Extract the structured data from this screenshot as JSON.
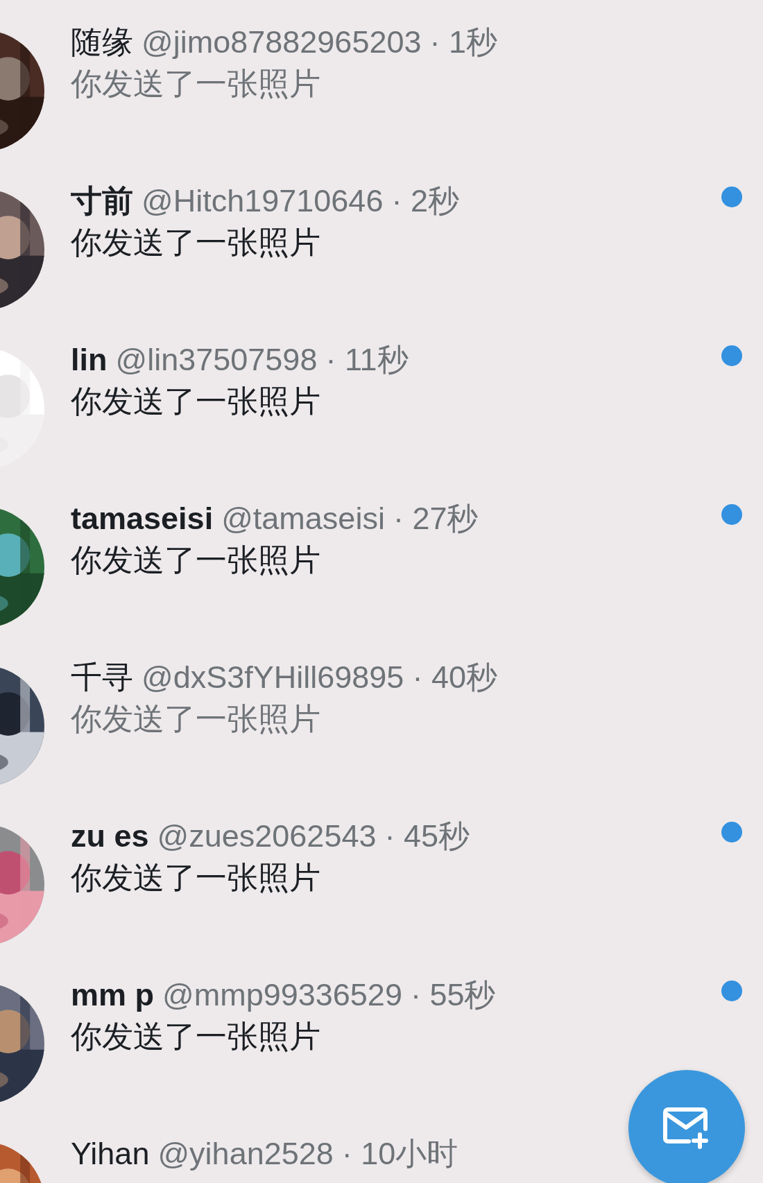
{
  "conversations": [
    {
      "name": "随缘",
      "handle": "@jimo87882965203",
      "time": "· 1秒",
      "preview": "你发送了一张照片",
      "unread": false
    },
    {
      "name": "寸前",
      "handle": "@Hitch19710646",
      "time": "· 2秒",
      "preview": "你发送了一张照片",
      "unread": true
    },
    {
      "name": "lin",
      "handle": "@lin37507598",
      "time": "· 11秒",
      "preview": "你发送了一张照片",
      "unread": true
    },
    {
      "name": "tamaseisi",
      "handle": "@tamaseisi",
      "time": "· 27秒",
      "preview": "你发送了一张照片",
      "unread": true
    },
    {
      "name": "千寻",
      "handle": "@dxS3fYHill69895",
      "time": "· 40秒",
      "preview": "你发送了一张照片",
      "unread": false
    },
    {
      "name": "zu es",
      "handle": "@zues2062543",
      "time": "· 45秒",
      "preview": "你发送了一张照片",
      "unread": true
    },
    {
      "name": "mm p",
      "handle": "@mmp99336529",
      "time": "· 55秒",
      "preview": "你发送了一张照片",
      "unread": true
    },
    {
      "name": "Yihan",
      "handle": "@yihan2528",
      "time": "· 10小时",
      "unread": false
    }
  ]
}
